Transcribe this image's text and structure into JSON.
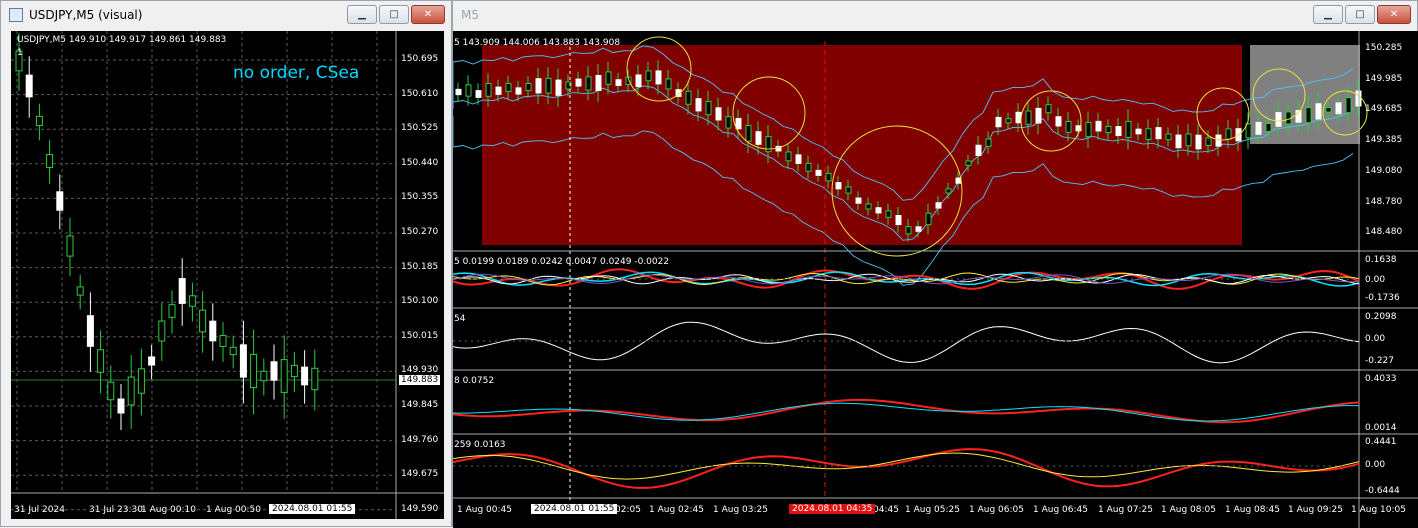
{
  "left_window": {
    "title": "USDJPY,M5 (visual)",
    "info": "USDJPY,M5  149.910 149.917 149.861 149.883",
    "marker": "1",
    "note": "no order, CSea",
    "current_price": "149.883",
    "price_labels": [
      "150.695",
      "150.610",
      "150.525",
      "150.440",
      "150.355",
      "150.270",
      "150.185",
      "150.100",
      "150.015",
      "149.930",
      "149.845",
      "149.760",
      "149.675",
      "149.590"
    ],
    "time_labels": [
      "31 Jul 2024",
      "31 Jul 23:30",
      "1 Aug 00:10",
      "1 Aug 00:50"
    ],
    "time_cursor": "2024.08.01 01:55",
    "controls": {
      "minimize": "▁",
      "maximize": "□",
      "close": "✕"
    }
  },
  "right_window": {
    "title": "M5",
    "info": "5  143.909 144.006 143.883 143.908",
    "price_labels": [
      "150.285",
      "149.985",
      "149.685",
      "149.385",
      "149.080",
      "148.780",
      "148.480"
    ],
    "sub1": {
      "info": "5 0.0199 0.0189 0.0242 0.0047 0.0249 -0.0022",
      "labels": [
        "0.1638",
        "0.00",
        "-0.1736"
      ]
    },
    "sub2": {
      "info": "54",
      "labels": [
        "0.2098",
        "0.00",
        "-0.227"
      ]
    },
    "sub3": {
      "info": "8 0.0752",
      "labels": [
        "0.4033",
        "0.0014"
      ]
    },
    "sub4": {
      "info": "259 0.0163",
      "labels": [
        "0.4441",
        "0.00",
        "-0.6444"
      ]
    },
    "time_labels": [
      "1 Aug 00:45",
      "02:05",
      "1 Aug 02:45",
      "1 Aug 03:25",
      "04:45",
      "1 Aug 05:25",
      "1 Aug 06:05",
      "1 Aug 06:45",
      "1 Aug 07:25",
      "1 Aug 08:05",
      "1 Aug 08:45",
      "1 Aug 09:25",
      "1 Aug 10:05"
    ],
    "time_cursor_white": "2024.08.01 01:55",
    "time_cursor_red": "2024.08.01 04:35",
    "controls": {
      "minimize": "▁",
      "maximize": "□",
      "close": "✕"
    }
  },
  "colors": {
    "background": "#000000",
    "bull": "#ffffff",
    "bear": "#2ecc40",
    "highlight_zone": "#800000",
    "circle": "#e8e040",
    "note": "#00d8ff"
  }
}
